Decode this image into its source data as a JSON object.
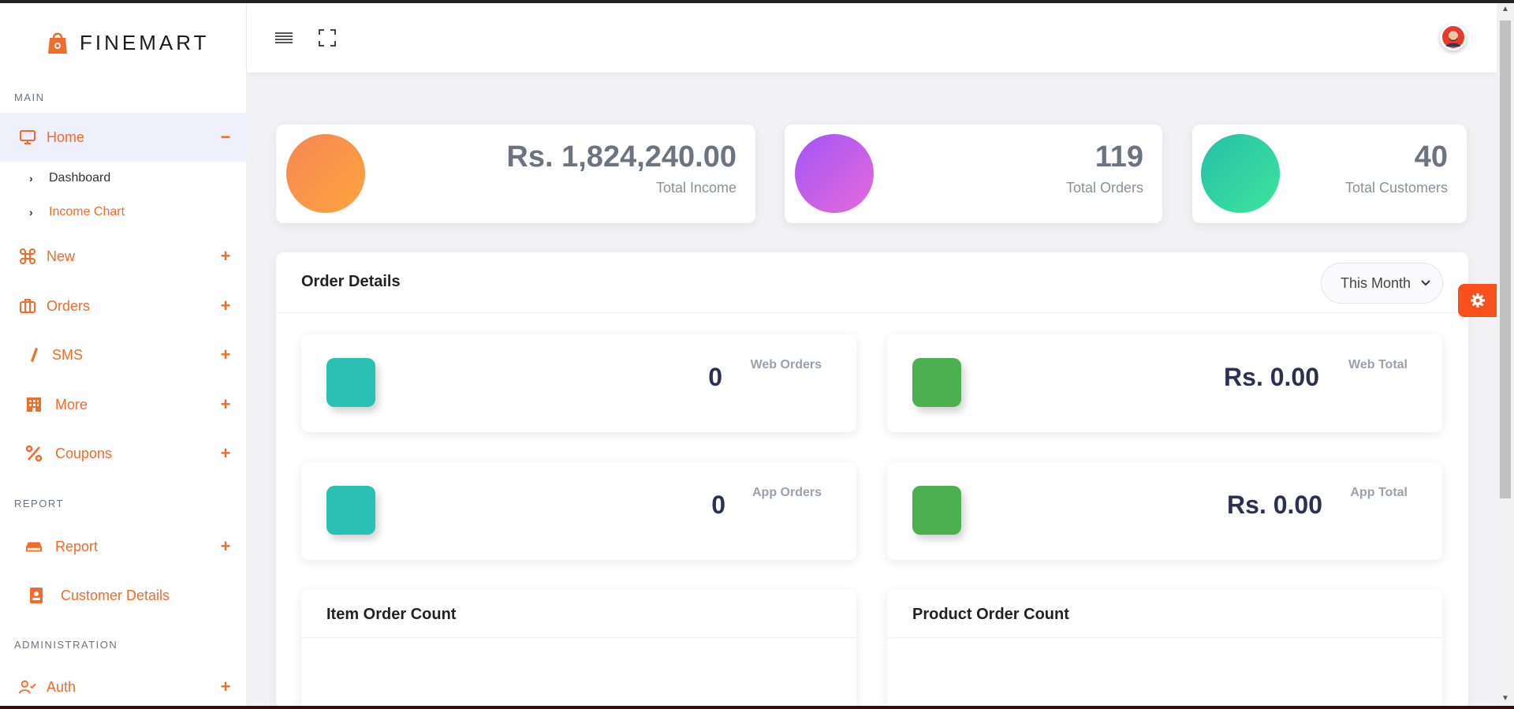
{
  "brand": {
    "name": "FINEMART",
    "accent": "#f26b2a"
  },
  "sidebar": {
    "sections": {
      "main": "MAIN",
      "report": "REPORT",
      "administration": "ADMINISTRATION"
    },
    "home": {
      "label": "Home",
      "toggle": "−",
      "icon": "monitor-icon"
    },
    "home_sub": [
      {
        "label": "Dashboard",
        "icon": "chevron-right-icon"
      },
      {
        "label": "Income Chart",
        "icon": "chevron-right-icon"
      }
    ],
    "items": [
      {
        "label": "New",
        "toggle": "+",
        "icon": "command-icon"
      },
      {
        "label": "Orders",
        "toggle": "+",
        "icon": "briefcase-icon"
      },
      {
        "label": "SMS",
        "toggle": "+",
        "icon": "pen-icon"
      },
      {
        "label": "More",
        "toggle": "+",
        "icon": "building-icon"
      },
      {
        "label": "Coupons",
        "toggle": "+",
        "icon": "percent-icon"
      }
    ],
    "report_items": [
      {
        "label": "Report",
        "toggle": "+",
        "icon": "hdd-icon"
      },
      {
        "label": "Customer Details",
        "toggle": "",
        "icon": "contact-card-icon"
      }
    ],
    "admin_items": [
      {
        "label": "Auth",
        "toggle": "+",
        "icon": "user-check-icon"
      }
    ]
  },
  "header": {
    "menu_icon": "hamburger-icon",
    "fullscreen_icon": "fullscreen-icon",
    "avatar_icon": "user-avatar-icon"
  },
  "stats": [
    {
      "value": "Rs. 1,824,240.00",
      "label": "Total Income",
      "color": "#f7933d"
    },
    {
      "value": "119",
      "label": "Total Orders",
      "color": "#b35cf2"
    },
    {
      "value": "40",
      "label": "Total Customers",
      "color": "#2ed3a4"
    }
  ],
  "order_details": {
    "title": "Order Details",
    "period": "This Month",
    "cards": [
      {
        "value": "0",
        "label": "Web Orders",
        "color": "#2ac1b4"
      },
      {
        "value": "Rs. 0.00",
        "label": "Web Total",
        "color": "#4caf50"
      },
      {
        "value": "0",
        "label": "App Orders",
        "color": "#2ac1b4"
      },
      {
        "value": "Rs. 0.00",
        "label": "App Total",
        "color": "#4caf50"
      }
    ],
    "item_count_title": "Item Order Count",
    "product_count_title": "Product Order Count"
  },
  "settings": {
    "icon": "gear-icon"
  }
}
